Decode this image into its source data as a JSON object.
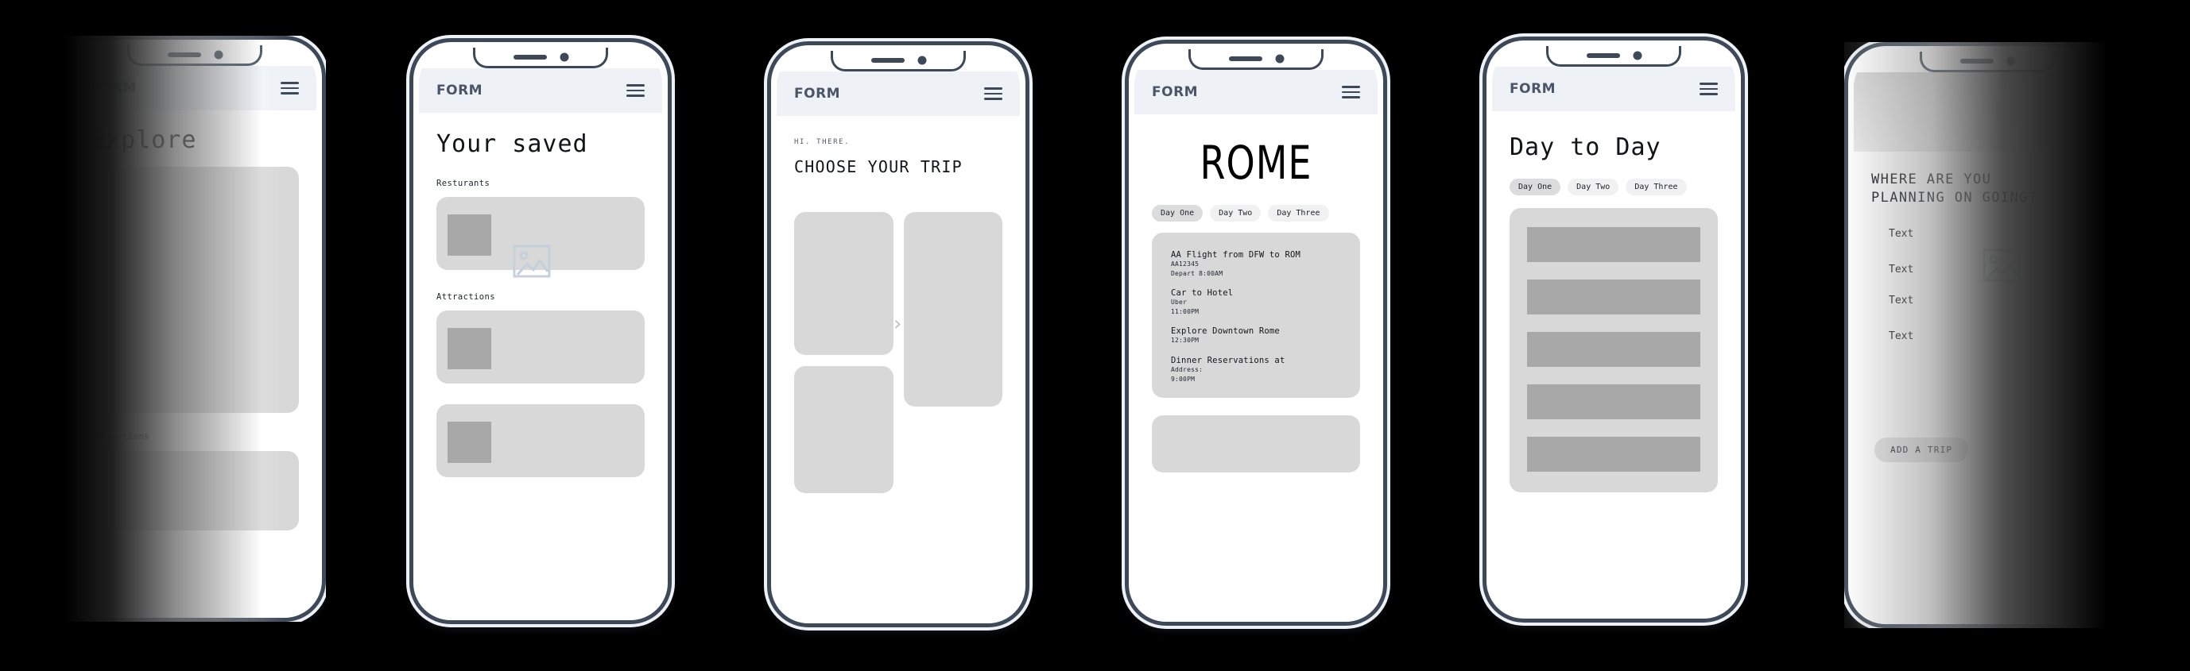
{
  "app": {
    "brand": "FORM",
    "menu_icon": "hamburger-icon"
  },
  "screens": [
    {
      "id": "explore",
      "title": "Explore",
      "section_label": "Attractions",
      "cards": 2
    },
    {
      "id": "saved",
      "title": "Your saved",
      "label_restaurants": "Resturants",
      "label_attractions": "Attractions",
      "image_icon": "image-placeholder-icon",
      "cards": 3
    },
    {
      "id": "choose-trip",
      "eyebrow": "HI. THERE.",
      "title": "CHOOSE YOUR TRIP",
      "arrow_icon": "chevron-right-icon",
      "cards": 3
    },
    {
      "id": "rome",
      "title": "ROME",
      "days": [
        {
          "label": "Day One",
          "active": true
        },
        {
          "label": "Day Two",
          "active": false
        },
        {
          "label": "Day Three",
          "active": false
        }
      ],
      "itinerary": [
        {
          "head": "AA Flight from DFW to ROM",
          "lines": [
            "AA12345",
            "Depart 8:00AM"
          ]
        },
        {
          "head": "Car to Hotel",
          "lines": [
            "Uber",
            "11:00PM"
          ]
        },
        {
          "head": "Explore Downtown Rome",
          "lines": [
            "12:30PM"
          ]
        },
        {
          "head": "Dinner Reservations at",
          "lines": [
            "Address:",
            "9:00PM"
          ]
        }
      ]
    },
    {
      "id": "day-to-day",
      "title": "Day to Day",
      "days": [
        {
          "label": "Day One",
          "active": true
        },
        {
          "label": "Day Two",
          "active": false
        },
        {
          "label": "Day Three",
          "active": false
        }
      ],
      "bars": 5
    },
    {
      "id": "where-going",
      "title_line1": "WHERE ARE YOU",
      "title_line2": "PLANNING ON GOING?",
      "text_fields": [
        "Text",
        "Text",
        "Text",
        "Text"
      ],
      "image_icon": "image-placeholder-icon",
      "add_trip_label": "ADD A TRIP"
    }
  ],
  "colors": {
    "background": "#000000",
    "device_frame": "#3d4858",
    "appbar": "#eef2f7",
    "card": "#d8d8d8",
    "thumb": "#a8a8a8",
    "pill_active": "#dcdcdc",
    "pill_idle": "#f1f1f1",
    "icon_outline": "#c5d0da"
  }
}
